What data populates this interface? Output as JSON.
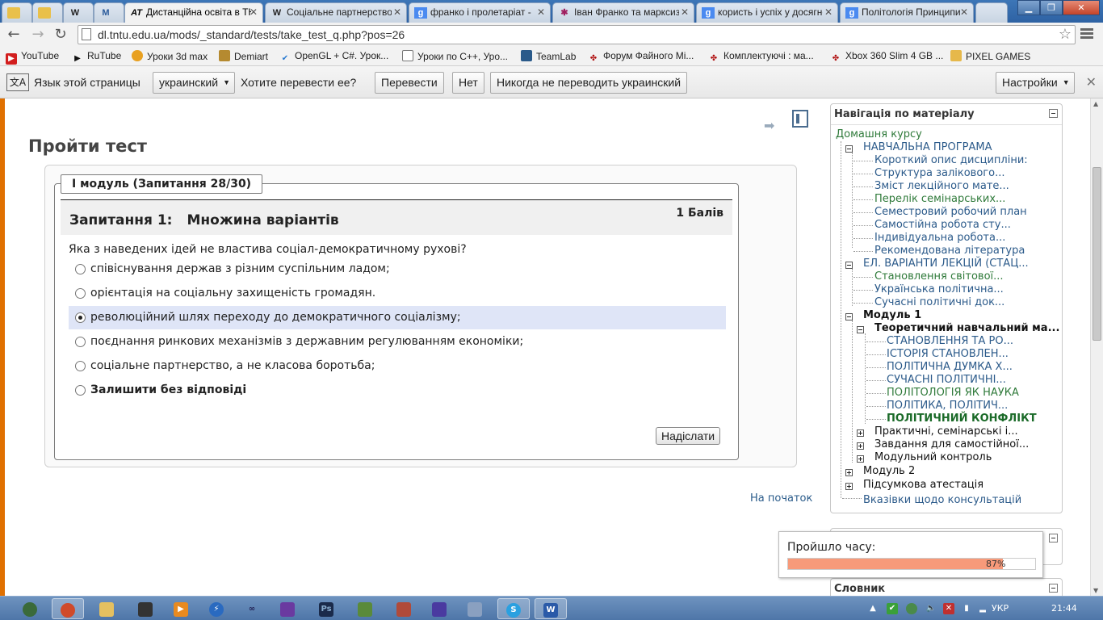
{
  "tabs": [
    {
      "favicon": "",
      "title": ""
    },
    {
      "favicon": "",
      "title": ""
    },
    {
      "favicon": "W",
      "title": ""
    },
    {
      "favicon": "M",
      "title": ""
    },
    {
      "favicon": "AT",
      "title": "Дистанційна освіта в ТНТУ"
    },
    {
      "favicon": "W",
      "title": "Соціальне партнерство"
    },
    {
      "favicon": "g",
      "title": "франко і пролетаріат -"
    },
    {
      "favicon": "✱",
      "title": "Іван Франко та марксизм"
    },
    {
      "favicon": "g",
      "title": "користь і успіх у досягнен"
    },
    {
      "favicon": "g",
      "title": "Політологія Принципи"
    }
  ],
  "address": {
    "url": "dl.tntu.edu.ua/mods/_standard/tests/take_test_q.php?pos=26"
  },
  "bookmarks": [
    "YouTube",
    "RuTube",
    "Уроки 3d max",
    "Demiart",
    "OpenGL + C#. Урок...",
    "Уроки по C++, Уро...",
    "TeamLab",
    "Форум Файного Мі...",
    "Комплектуючі : ма...",
    "Xbox 360 Slim 4 GB ...",
    "PIXEL GAMES"
  ],
  "translate": {
    "label": "Язык этой страницы",
    "lang": "украинский",
    "question": "Хотите перевести ее?",
    "translate": "Перевести",
    "no": "Нет",
    "never": "Никогда не переводить украинский",
    "settings": "Настройки"
  },
  "page": {
    "title": "Пройти тест",
    "module": "I модуль (Запитання 28/30)",
    "question_num": "Запитання 1:",
    "question_type": "Множина варіантів",
    "score": "1 Балів",
    "question_text": "Яка з наведених ідей не властива соціал-демократичному рухові?",
    "options": [
      "співіснування держав з різним суспільним ладом;",
      "орієнтація на соціальну захищеність громадян.",
      "революційний шлях переходу до демократичного соціалізму;",
      "поєднання ринкових механізмів з державним регулюванням економіки;",
      "соціальне партнерство, а не класова боротьба;",
      "Залишити без відповіді"
    ],
    "selected_option": 2,
    "submit": "Надіслати",
    "to_top": "На початок"
  },
  "nav": {
    "title": "Навігація по матеріалу",
    "home": "Домашня курсу",
    "items": [
      "НАВЧАЛЬНА ПРОГРАМА",
      "Короткий опис дисципліни:",
      "Структура залікового...",
      "Зміст лекційного мате...",
      "Перелік семінарських...",
      "Семестровий робочий план",
      "Самостійна робота сту...",
      "Індивідуальна робота...",
      "Рекомендована література",
      "ЕЛ. ВАРІАНТИ ЛЕКЦІЙ (СТАЦ...",
      "Становлення світової...",
      "Українська політична...",
      "Сучасні політичні док...",
      "Модуль 1",
      "Теоретичний навчальний ма...",
      "СТАНОВЛЕННЯ ТА РО...",
      "ІСТОРІЯ СТАНОВЛЕН...",
      "ПОЛІТИЧНА ДУМКА Х...",
      "СУЧАСНІ ПОЛІТИЧНІ...",
      "ПОЛІТОЛОГІЯ ЯК НАУКА",
      "ПОЛІТИКА, ПОЛІТИЧ...",
      "ПОЛІТИЧНИЙ КОНФЛІКТ",
      "Практичні, семінарські і...",
      "Завдання для самостійної...",
      "Модульний контроль",
      "Модуль 2",
      "Підсумкова атестація",
      "Вказівки щодо консультацій"
    ]
  },
  "timer": {
    "label": "Пройшло часу:",
    "percent_text": "87%",
    "percent": 87
  },
  "dictionary": {
    "title": "Словник"
  },
  "taskbar": {
    "lang": "УКР",
    "clock": "21:44"
  },
  "colors": {
    "accent": "#e07000",
    "progress": "#f79a7a",
    "selected": "#dfe5f7"
  }
}
